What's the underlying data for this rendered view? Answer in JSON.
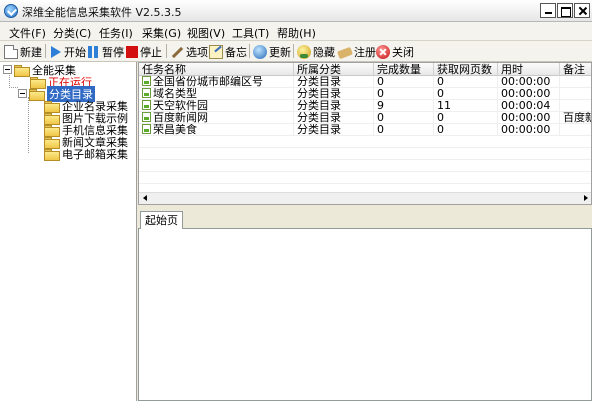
{
  "window": {
    "title": "深维全能信息采集软件 V2.5.3.5"
  },
  "menu": [
    {
      "label": "文件(F)"
    },
    {
      "label": "分类(C)"
    },
    {
      "label": "任务(I)"
    },
    {
      "label": "采集(G)"
    },
    {
      "label": "视图(V)"
    },
    {
      "label": "工具(T)"
    },
    {
      "label": "帮助(H)"
    }
  ],
  "toolbar": {
    "new": "新建",
    "start": "开始",
    "pause": "暂停",
    "stop": "停止",
    "options": "选项",
    "memo": "备忘",
    "update": "更新",
    "hide": "隐藏",
    "register": "注册",
    "close": "关闭"
  },
  "tree": {
    "root": "全能采集",
    "running": "正在运行",
    "category": "分类目录",
    "children": [
      "企业名录采集",
      "图片下载示例",
      "手机信息采集",
      "新闻文章采集",
      "电子邮箱采集"
    ]
  },
  "table": {
    "columns": [
      "任务名称",
      "所属分类",
      "完成数量",
      "获取网页数",
      "用时",
      "备注"
    ],
    "rows": [
      [
        "全国省份城市邮编区号",
        "分类目录",
        "0",
        "0",
        "00:00:00",
        ""
      ],
      [
        "域名类型",
        "分类目录",
        "0",
        "0",
        "00:00:00",
        ""
      ],
      [
        "天空软件园",
        "分类目录",
        "9",
        "11",
        "00:00:04",
        ""
      ],
      [
        "百度新闻网",
        "分类目录",
        "0",
        "0",
        "00:00:00",
        "百度新"
      ],
      [
        "荣昌美食",
        "分类目录",
        "0",
        "0",
        "00:00:00",
        ""
      ]
    ]
  },
  "tabs": {
    "start_page": "起始页"
  }
}
